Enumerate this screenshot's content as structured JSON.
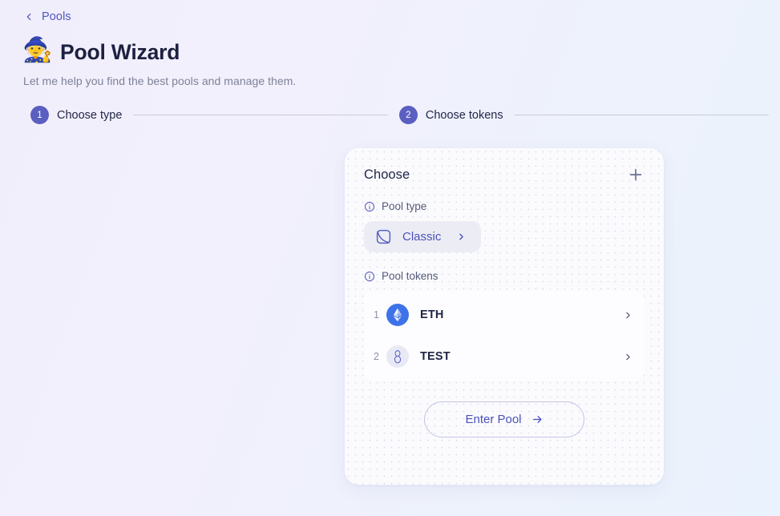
{
  "breadcrumb": {
    "back_icon": "chevron-left-icon",
    "label": "Pools"
  },
  "header": {
    "emoji": "🧙",
    "emoji_name": "wizard-emoji",
    "title": "Pool Wizard",
    "subtitle": "Let me help you find the best pools and manage them."
  },
  "stepper": {
    "steps": [
      {
        "number": "1",
        "label": "Choose type"
      },
      {
        "number": "2",
        "label": "Choose tokens"
      }
    ]
  },
  "card": {
    "title": "Choose",
    "add_icon": "plus-icon",
    "pool_type": {
      "label": "Pool type",
      "info_icon": "info-icon",
      "selected": "Classic",
      "selected_icon": "classic-pool-icon",
      "chevron": "chevron-right-icon"
    },
    "pool_tokens": {
      "label": "Pool tokens",
      "info_icon": "info-icon",
      "rows": [
        {
          "index": "1",
          "symbol": "ETH",
          "logo": "ethereum-logo",
          "chevron": "chevron-right-icon"
        },
        {
          "index": "2",
          "symbol": "TEST",
          "logo": "test-token-logo",
          "chevron": "chevron-right-icon"
        }
      ]
    },
    "submit": {
      "label": "Enter Pool",
      "icon": "arrow-right-icon"
    }
  },
  "colors": {
    "accent": "#4b51bc",
    "step_badge": "#5b5fc0",
    "eth_blue": "#3e72e8",
    "card_bg": "#fbfbfe",
    "text_dark": "#1d2140",
    "text_muted": "#7d8199"
  }
}
